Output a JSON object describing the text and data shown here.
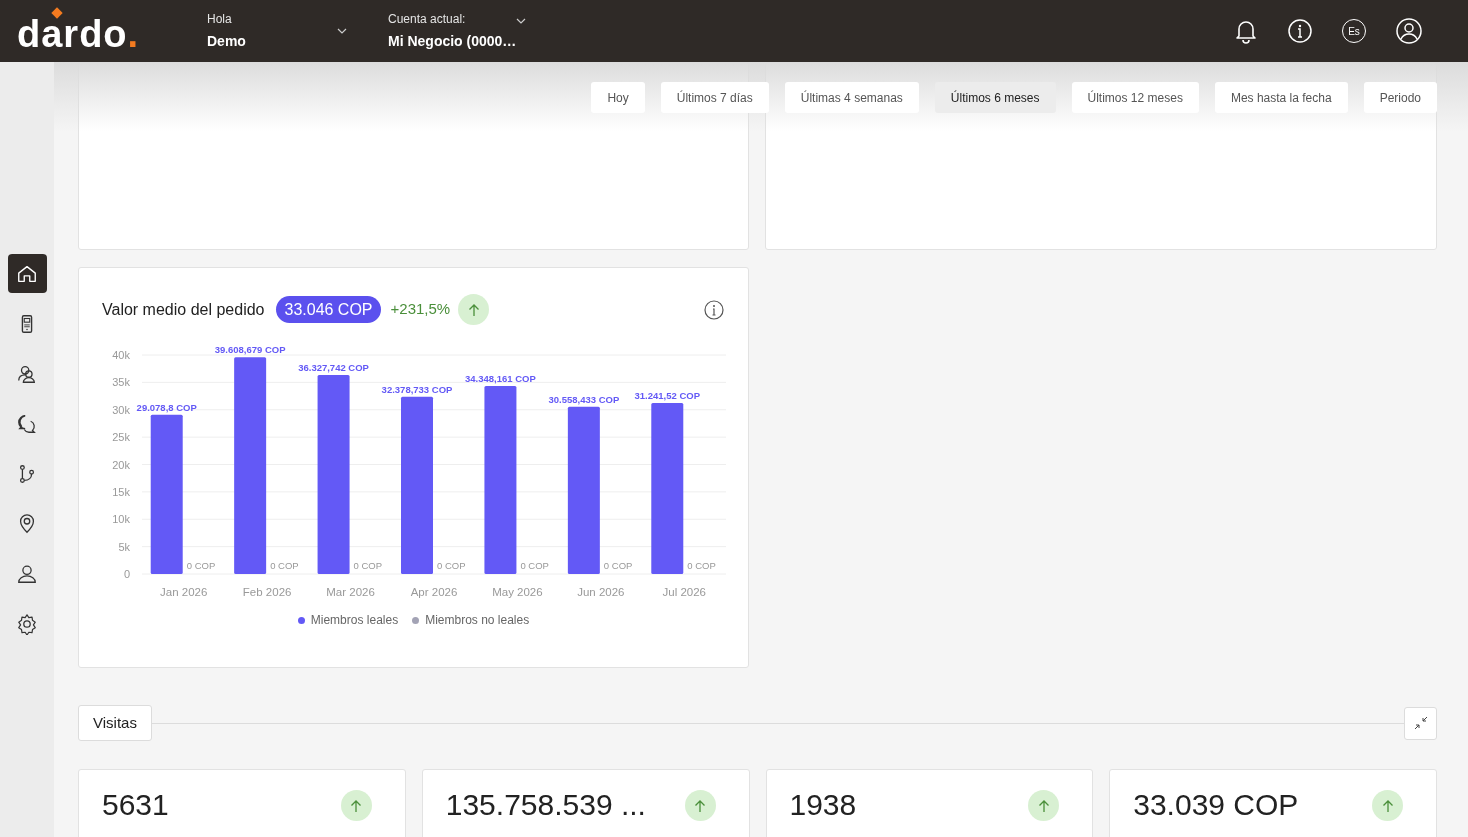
{
  "header": {
    "logo": {
      "name": "dardo",
      "mark": "."
    },
    "greeting": {
      "label": "Hola",
      "value": "Demo"
    },
    "account": {
      "label": "Cuenta actual:",
      "value": "Mi Negocio (0000…"
    },
    "language": "Es"
  },
  "sidebar": {
    "items": [
      {
        "kind": "home",
        "selected": true
      },
      {
        "kind": "device",
        "selected": false
      },
      {
        "kind": "people",
        "selected": false
      },
      {
        "kind": "chat",
        "selected": false
      },
      {
        "kind": "flow",
        "selected": false
      },
      {
        "kind": "pin",
        "selected": false
      },
      {
        "kind": "user",
        "selected": false
      },
      {
        "kind": "gear",
        "selected": false
      }
    ]
  },
  "filters": [
    {
      "label": "Hoy",
      "selected": false
    },
    {
      "label": "Últimos 7 días",
      "selected": false
    },
    {
      "label": "Últimas 4 semanas",
      "selected": false
    },
    {
      "label": "Últimos 6 meses",
      "selected": true
    },
    {
      "label": "Últimos 12 meses",
      "selected": false
    },
    {
      "label": "Mes hasta la fecha",
      "selected": false
    },
    {
      "label": "Periodo",
      "selected": false
    }
  ],
  "order_card": {
    "title": "Valor medio del pedido",
    "value": "33.046 COP",
    "change": "+231,5%",
    "chart_data": {
      "type": "bar",
      "categories": [
        "Jan 2026",
        "Feb 2026",
        "Mar 2026",
        "Apr 2026",
        "May 2026",
        "Jun 2026",
        "Jul 2026"
      ],
      "series": [
        {
          "name": "Miembros leales",
          "color": "#6359f6",
          "values": [
            29078.8,
            39608.679,
            36327.742,
            32378.733,
            34348.161,
            30558.433,
            31241.52
          ]
        },
        {
          "name": "Miembros no leales",
          "color": "#a3a3b5",
          "values": [
            0,
            0,
            0,
            0,
            0,
            0,
            0
          ]
        }
      ],
      "ylim": [
        0,
        40000
      ],
      "grid": true,
      "yticks": [
        {
          "value": 0,
          "label": "0"
        },
        {
          "value": 5000,
          "label": "5k"
        },
        {
          "value": 10000,
          "label": "10k"
        },
        {
          "value": 15000,
          "label": "15k"
        },
        {
          "value": 20000,
          "label": "20k"
        },
        {
          "value": 25000,
          "label": "25k"
        },
        {
          "value": 30000,
          "label": "30k"
        },
        {
          "value": 35000,
          "label": "35k"
        },
        {
          "value": 40000,
          "label": "40k"
        }
      ],
      "value_labels": [
        [
          "29.078,8 COP",
          "39.608,679 COP",
          "36.327,742 COP",
          "32.378,733 COP",
          "34.348,161 COP",
          "30.558,433 COP",
          "31.241,52 COP"
        ],
        [
          "0 COP",
          "0 COP",
          "0 COP",
          "0 COP",
          "0 COP",
          "0 COP",
          "0 COP"
        ]
      ]
    }
  },
  "visits": {
    "title": "Visitas",
    "stats": [
      {
        "value": "5631"
      },
      {
        "value": "135.758.539 ..."
      },
      {
        "value": "1938"
      },
      {
        "value": "33.039 COP"
      }
    ]
  }
}
